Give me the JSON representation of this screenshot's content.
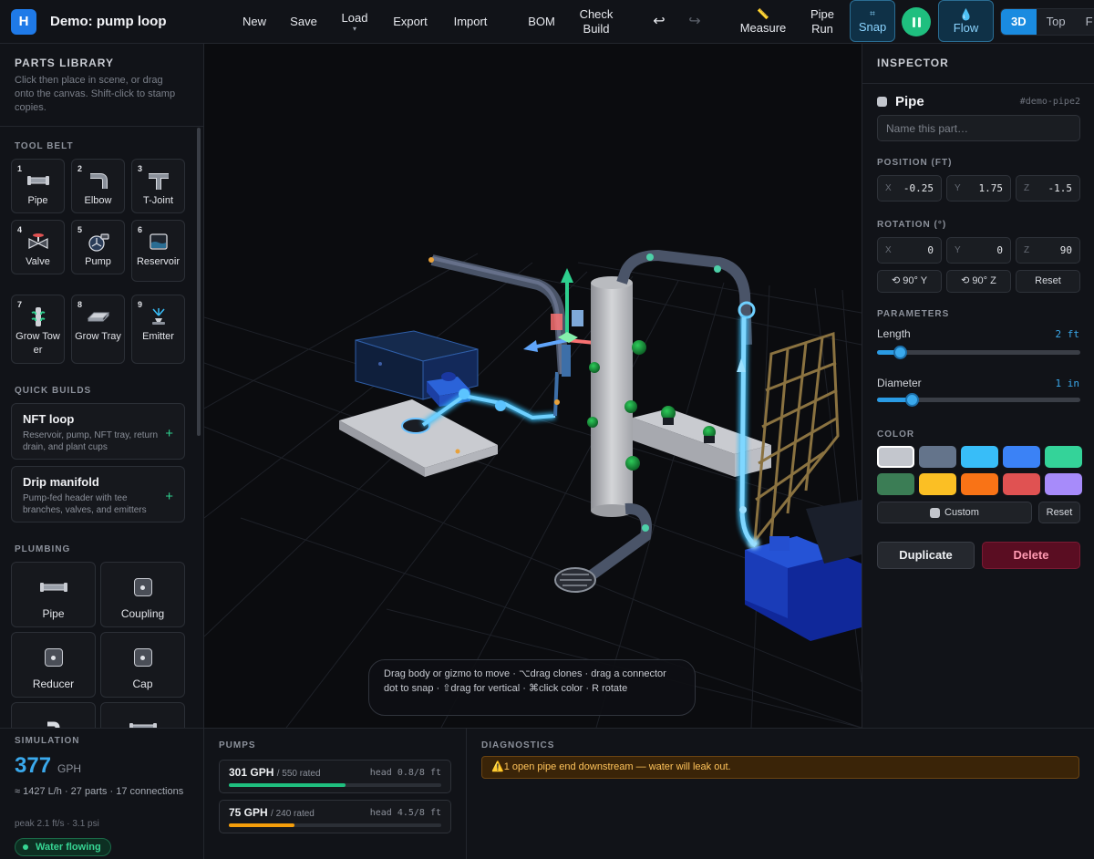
{
  "app": {
    "logo_letter": "H",
    "title": "Demo: pump loop"
  },
  "toolbar": {
    "new": "New",
    "save": "Save",
    "load": "Load",
    "load_caret": "▾",
    "export": "Export",
    "import": "Import",
    "bom": "BOM",
    "check_build_1": "Check",
    "check_build_2": "Build",
    "undo": "↩",
    "redo": "↪",
    "measure": "Measure",
    "measure_icon": "📏",
    "pipe_run_1": "Pipe",
    "pipe_run_2": "Run",
    "snap": "Snap",
    "snap_icon": "⌗",
    "flow": "Flow",
    "flow_icon": "💧",
    "views": [
      "3D",
      "Top",
      "F"
    ],
    "active_view": "3D"
  },
  "library": {
    "title": "PARTS LIBRARY",
    "hint": "Click then place in scene, or drag onto the canvas. Shift-click to stamp copies.",
    "tool_belt_title": "TOOL BELT",
    "tool_belt": [
      {
        "num": "1",
        "label": "Pipe",
        "icon": "pipe-icon"
      },
      {
        "num": "2",
        "label": "Elbow",
        "icon": "elbow-icon"
      },
      {
        "num": "3",
        "label": "T-Joint",
        "icon": "tee-icon"
      },
      {
        "num": "4",
        "label": "Valve",
        "icon": "valve-icon"
      },
      {
        "num": "5",
        "label": "Pump",
        "icon": "pump-icon"
      },
      {
        "num": "6",
        "label": "Reservoir",
        "icon": "reservoir-icon"
      },
      {
        "num": "7",
        "label": "Grow Tower",
        "icon": "grow-tower-icon"
      },
      {
        "num": "8",
        "label": "Grow Tray",
        "icon": "grow-tray-icon"
      },
      {
        "num": "9",
        "label": "Emitter",
        "icon": "emitter-icon"
      }
    ],
    "quick_builds_title": "QUICK BUILDS",
    "quick_builds": [
      {
        "title": "NFT loop",
        "desc": "Reservoir, pump, NFT tray, return drain, and plant cups",
        "action": "+"
      },
      {
        "title": "Drip manifold",
        "desc": "Pump-fed header with tee branches, valves, and emitters",
        "action": "+"
      }
    ],
    "plumbing_title": "PLUMBING",
    "plumbing": [
      "Pipe",
      "Coupling",
      "Reducer",
      "Cap"
    ]
  },
  "canvas": {
    "hint": "Drag body or gizmo to move · ⌥drag clones · drag a connector dot to snap · ⇧drag for vertical · ⌘click color · R rotate"
  },
  "inspector": {
    "title": "INSPECTOR",
    "part_name": "Pipe",
    "part_id": "#demo-pipe2",
    "name_placeholder": "Name this part…",
    "position_label": "POSITION (FT)",
    "position": {
      "x": "-0.25",
      "y": "1.75",
      "z": "-1.5"
    },
    "rotation_label": "ROTATION (°)",
    "rotation": {
      "x": "0",
      "y": "0",
      "z": "90"
    },
    "axis_labels": {
      "x": "X",
      "y": "Y",
      "z": "Z"
    },
    "rotate_y": "⟲ 90° Y",
    "rotate_z": "⟲ 90° Z",
    "rotation_reset": "Reset",
    "parameters_label": "PARAMETERS",
    "length_label": "Length",
    "length_value": "2 ft",
    "length_fraction": 0.11,
    "diameter_label": "Diameter",
    "diameter_value": "1 in",
    "diameter_fraction": 0.17,
    "color_label": "COLOR",
    "colors": [
      "#c3c6cd",
      "#64748b",
      "#38bdf8",
      "#3b82f6",
      "#34d399",
      "#3b7d55",
      "#fbbf24",
      "#f97316",
      "#e05252",
      "#a78bfa"
    ],
    "selected_color": "#c3c6cd",
    "custom_label": "Custom",
    "color_reset": "Reset",
    "duplicate": "Duplicate",
    "delete": "Delete"
  },
  "simulation": {
    "title": "SIMULATION",
    "flow_value": "377",
    "flow_unit": "GPH",
    "summary": "≈ 1427 L/h · 27 parts · 17 connections",
    "peak": "peak 2.1 ft/s · 3.1 psi",
    "status": "Water flowing"
  },
  "pumps": {
    "title": "PUMPS",
    "items": [
      {
        "flow": "301 GPH",
        "rated": "/ 550 rated",
        "head": "head 0.8/8 ft",
        "fraction": 0.55,
        "color": "#1fbf7f"
      },
      {
        "flow": "75 GPH",
        "rated": "/ 240 rated",
        "head": "head 4.5/8 ft",
        "fraction": 0.31,
        "color": "#f59e0b"
      }
    ]
  },
  "diagnostics": {
    "title": "DIAGNOSTICS",
    "messages": [
      {
        "icon": "⚠️",
        "text": "1 open pipe end downstream — water will leak out."
      }
    ]
  }
}
